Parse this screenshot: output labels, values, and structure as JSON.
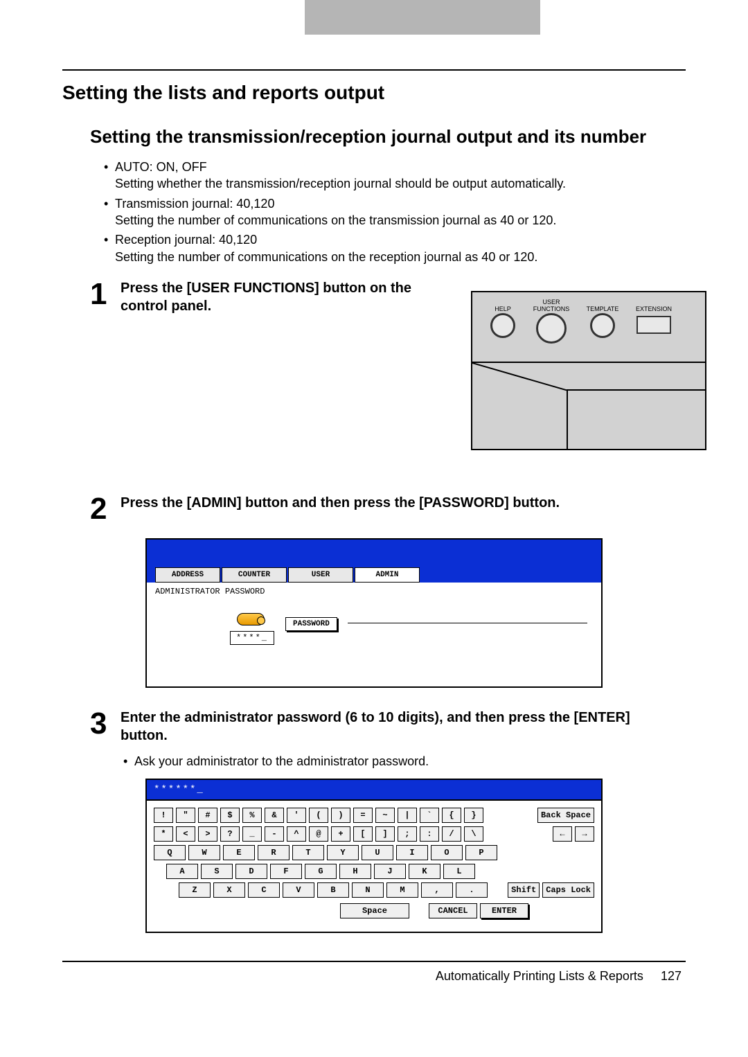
{
  "header_tab": "",
  "section_title": "Setting the lists and reports output",
  "sub_title": "Setting the transmission/reception journal output and its number",
  "bullets": [
    {
      "head": "AUTO: ON, OFF",
      "body": "Setting whether the transmission/reception journal should be output automatically."
    },
    {
      "head": "Transmission journal: 40,120",
      "body": "Setting the number of communications on the transmission journal as 40 or 120."
    },
    {
      "head": "Reception journal: 40,120",
      "body": "Setting the number of communications on the reception journal as 40 or 120."
    }
  ],
  "steps": {
    "s1": {
      "num": "1",
      "text": "Press the [USER FUNCTIONS] button on the control panel."
    },
    "s2": {
      "num": "2",
      "text": "Press the [ADMIN] button and then press the [PASSWORD] button."
    },
    "s3": {
      "num": "3",
      "text": "Enter the administrator password (6 to 10 digits), and then press the [ENTER] button.",
      "note": "Ask your administrator to the administrator password."
    }
  },
  "panel": {
    "help": "HELP",
    "user_functions": "USER\nFUNCTIONS",
    "template": "TEMPLATE",
    "extension": "EXTENSION"
  },
  "admin_screen": {
    "tabs": [
      "ADDRESS",
      "COUNTER",
      "USER",
      "ADMIN"
    ],
    "active_tab_index": 3,
    "label": "ADMINISTRATOR PASSWORD",
    "stars": "****_",
    "password_btn": "PASSWORD"
  },
  "kbd": {
    "input": "******_",
    "row1": [
      "!",
      "\"",
      "#",
      "$",
      "%",
      "&",
      "'",
      "(",
      ")",
      "=",
      "~",
      "|",
      "`",
      "{",
      "}"
    ],
    "row1_tail": "Back Space",
    "row2": [
      "*",
      "<",
      ">",
      "?",
      "_",
      "-",
      "^",
      "@",
      "+",
      "[",
      "]",
      ";",
      ":",
      "/",
      "\\"
    ],
    "row2_tail": [
      "←",
      "→"
    ],
    "row3": [
      "Q",
      "W",
      "E",
      "R",
      "T",
      "Y",
      "U",
      "I",
      "O",
      "P"
    ],
    "row4": [
      "A",
      "S",
      "D",
      "F",
      "G",
      "H",
      "J",
      "K",
      "L"
    ],
    "row5": [
      "Z",
      "X",
      "C",
      "V",
      "B",
      "N",
      "M",
      ",",
      "."
    ],
    "row5_tail": [
      "Shift",
      "Caps Lock"
    ],
    "row6": {
      "space": "Space",
      "cancel": "CANCEL",
      "enter": "ENTER"
    }
  },
  "footer": {
    "text": "Automatically Printing Lists & Reports",
    "page": "127"
  }
}
